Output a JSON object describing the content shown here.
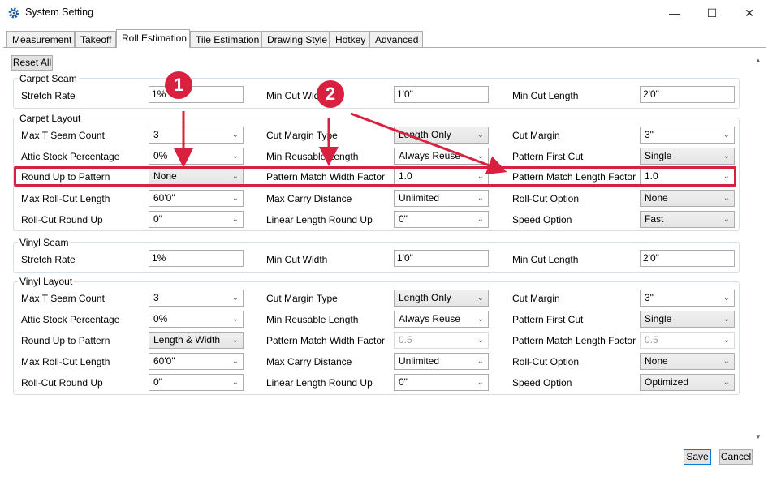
{
  "window": {
    "title": "System Setting",
    "minimize": "—",
    "maximize": "☐",
    "close": "✕"
  },
  "tabs": [
    "Measurement",
    "Takeoff",
    "Roll Estimation",
    "Tile Estimation",
    "Drawing Style",
    "Hotkey",
    "Advanced"
  ],
  "reset_all": "Reset All",
  "carpet_seam": {
    "title": "Carpet Seam",
    "stretch_rate": {
      "label": "Stretch Rate",
      "value": "1%"
    },
    "min_cut_width": {
      "label": "Min Cut Wid",
      "value": "1'0\""
    },
    "min_cut_length": {
      "label": "Min Cut Length",
      "value": "2'0\""
    }
  },
  "carpet_layout": {
    "title": "Carpet Layout",
    "max_t_seam": {
      "label": "Max T Seam Count",
      "value": "3"
    },
    "cut_margin_type": {
      "label": "Cut Margin Type",
      "value": "Length Only"
    },
    "cut_margin": {
      "label": "Cut Margin",
      "value": "3\""
    },
    "attic_stock": {
      "label": "Attic Stock Percentage",
      "value": "0%"
    },
    "min_reusable": {
      "label": "Min Reusable Length",
      "value": "Always Reuse"
    },
    "pattern_first_cut": {
      "label": "Pattern First Cut",
      "value": "Single"
    },
    "round_up": {
      "label": "Round Up to Pattern",
      "value": "None"
    },
    "pm_width": {
      "label": "Pattern Match Width Factor",
      "value": "1.0"
    },
    "pm_length": {
      "label": "Pattern Match Length Factor",
      "value": "1.0"
    },
    "max_roll_cut": {
      "label": "Max Roll-Cut Length",
      "value": "60'0\""
    },
    "max_carry": {
      "label": "Max Carry Distance",
      "value": "Unlimited"
    },
    "roll_cut_option": {
      "label": "Roll-Cut Option",
      "value": "None"
    },
    "roll_cut_round": {
      "label": "Roll-Cut Round Up",
      "value": "0\""
    },
    "linear_round": {
      "label": "Linear Length Round Up",
      "value": "0\""
    },
    "speed": {
      "label": "Speed Option",
      "value": "Fast"
    }
  },
  "vinyl_seam": {
    "title": "Vinyl Seam",
    "stretch_rate": {
      "label": "Stretch Rate",
      "value": "1%"
    },
    "min_cut_width": {
      "label": "Min Cut Width",
      "value": "1'0\""
    },
    "min_cut_length": {
      "label": "Min Cut Length",
      "value": "2'0\""
    }
  },
  "vinyl_layout": {
    "title": "Vinyl Layout",
    "max_t_seam": {
      "label": "Max T Seam Count",
      "value": "3"
    },
    "cut_margin_type": {
      "label": "Cut Margin Type",
      "value": "Length Only"
    },
    "cut_margin": {
      "label": "Cut Margin",
      "value": "3\""
    },
    "attic_stock": {
      "label": "Attic Stock Percentage",
      "value": "0%"
    },
    "min_reusable": {
      "label": "Min Reusable Length",
      "value": "Always Reuse"
    },
    "pattern_first_cut": {
      "label": "Pattern First Cut",
      "value": "Single"
    },
    "round_up": {
      "label": "Round Up to Pattern",
      "value": "Length & Width"
    },
    "pm_width": {
      "label": "Pattern Match Width Factor",
      "value": "0.5"
    },
    "pm_length": {
      "label": "Pattern Match Length Factor",
      "value": "0.5"
    },
    "max_roll_cut": {
      "label": "Max Roll-Cut Length",
      "value": "60'0\""
    },
    "max_carry": {
      "label": "Max Carry Distance",
      "value": "Unlimited"
    },
    "roll_cut_option": {
      "label": "Roll-Cut Option",
      "value": "None"
    },
    "roll_cut_round": {
      "label": "Roll-Cut Round Up",
      "value": "0\""
    },
    "linear_round": {
      "label": "Linear Length Round Up",
      "value": "0\""
    },
    "speed": {
      "label": "Speed Option",
      "value": "Optimized"
    }
  },
  "annotations": {
    "badge1": "1",
    "badge2": "2",
    "color": "#d9213f"
  },
  "footer": {
    "save": "Save",
    "cancel": "Cancel"
  },
  "icons": {
    "app": "gear-icon",
    "dropdown": "chevron-down-icon"
  }
}
